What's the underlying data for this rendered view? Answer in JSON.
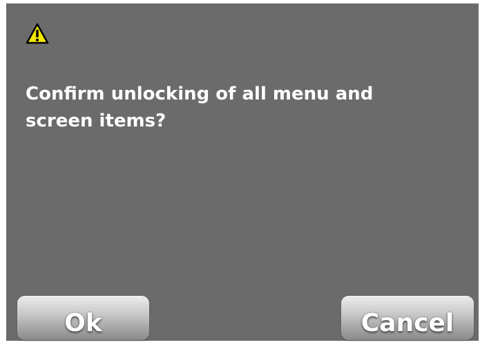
{
  "dialog": {
    "icon": "warning-icon",
    "message_line1": "Confirm unlocking of all menu and",
    "message_line2": "screen items?",
    "ok_label": "Ok",
    "cancel_label": "Cancel"
  },
  "colors": {
    "background": "#6b6b6b",
    "text": "#ffffff",
    "warning_fill": "#f2e600",
    "button_top": "#ececec",
    "button_bottom": "#8a8a8a"
  }
}
